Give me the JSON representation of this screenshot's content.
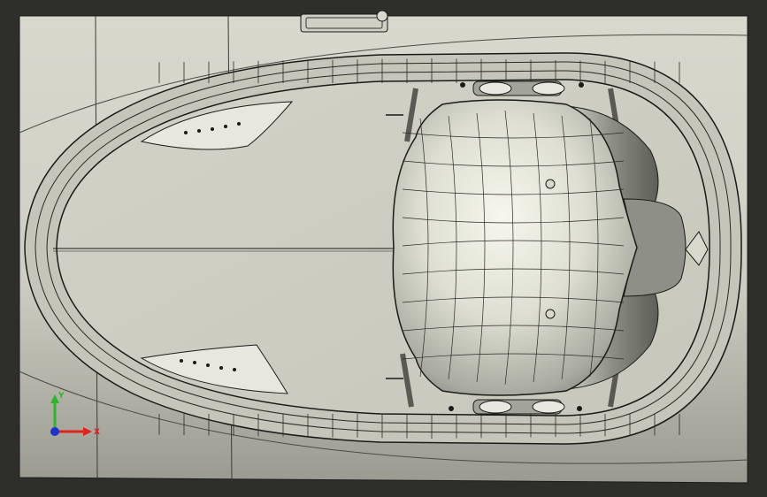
{
  "viewport": {
    "view_name": "top-view",
    "colors": {
      "background_dark": "#2e2f2b",
      "hull_light": "#d7d7cc",
      "hull_shadow": "#8e8e84",
      "edge_line": "#1a1a16",
      "rim_fill": "#c9c9be",
      "seat_highlight": "#f4f4ea",
      "seat_shadow": "#6f6f66"
    }
  },
  "triad": {
    "x_label": "X",
    "y_label": "Y",
    "x_color": "#e0221c",
    "y_color": "#2db52d",
    "z_color": "#2233cc"
  }
}
